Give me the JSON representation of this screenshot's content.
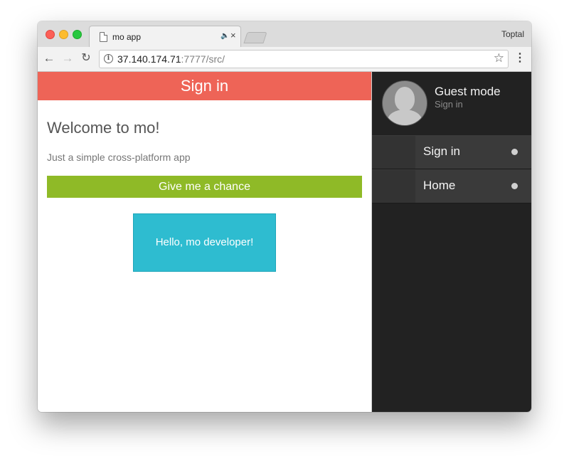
{
  "browser": {
    "tab_title": "mo app",
    "profile_name": "Toptal",
    "url_host": "37.140.174.71",
    "url_rest": ":7777/src/"
  },
  "app": {
    "header_title": "Sign in",
    "welcome_heading": "Welcome to mo!",
    "subtitle": "Just a simple cross-platform app",
    "chance_button_label": "Give me a chance",
    "hello_text": "Hello, mo developer!"
  },
  "drawer": {
    "user_title": "Guest mode",
    "user_subtitle": "Sign in",
    "items": [
      {
        "label": "Sign in"
      },
      {
        "label": "Home"
      }
    ]
  },
  "icons": {
    "tab_file": "file-icon",
    "tab_audio": "speaker-icon",
    "tab_close": "close-icon",
    "back": "arrow-left-icon",
    "forward": "arrow-right-icon",
    "reload": "reload-icon",
    "info": "info-icon",
    "bookmark": "star-icon",
    "menu": "kebab-menu-icon",
    "avatar": "user-avatar-icon"
  },
  "colors": {
    "header": "#ee6457",
    "chance_button": "#8fba27",
    "hello_box": "#2ebcd0",
    "drawer": "#222222"
  }
}
